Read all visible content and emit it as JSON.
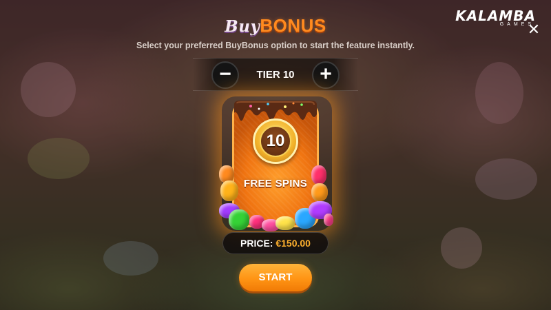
{
  "header": {
    "title_buy": "Buy",
    "title_bonus": "BONUS",
    "subtitle": "Select your preferred BuyBonus option to start the feature instantly."
  },
  "logo": {
    "main": "KALAMBA",
    "sub": "GAMES"
  },
  "close": {
    "icon": "close-icon",
    "glyph": "✕"
  },
  "tier": {
    "label": "TIER 10",
    "minus_glyph": "−",
    "plus_glyph": "+"
  },
  "card": {
    "spins_count": "10",
    "label": "FREE SPINS"
  },
  "price": {
    "label": "PRICE: ",
    "value": "€150.00"
  },
  "start": {
    "label": "START"
  },
  "colors": {
    "accent": "#ff9414",
    "price_value": "#ffb12e",
    "card": "#f07411"
  }
}
